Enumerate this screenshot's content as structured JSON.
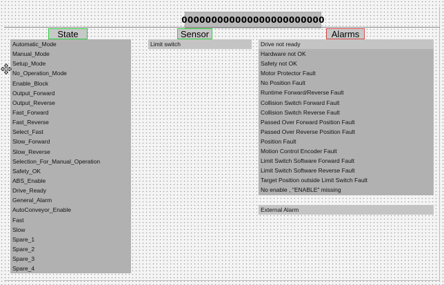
{
  "title": "000000000000000000000000",
  "headers": {
    "state": "State",
    "sensor": "Sensor",
    "alarms": "Alarms"
  },
  "state_items": [
    "Automatic_Mode",
    "Manual_Mode",
    "Setup_Mode",
    "No_Operation_Mode",
    "Enable_Block",
    "Output_Forward",
    "Output_Reverse",
    "Fast_Forward",
    "Fast_Reverse",
    "Select_Fast",
    "Slow_Forward",
    "Slow_Reverse",
    "Selection_For_Manual_Operation",
    "Safety_OK",
    "ABS_Enable",
    "Drive_Ready",
    "General_Alarm",
    "AutoConveyor_Enable",
    "Fast",
    "Slow",
    "Spare_1",
    "Spare_2",
    "Spare_3",
    "Spare_4"
  ],
  "sensor_items": [
    "Limit switch"
  ],
  "alarm_items": [
    "Drive not ready",
    "Hardware not OK",
    "Safety not OK",
    "Motor Protector Fault",
    "No Position Fault",
    "Runtime Forward/Reverse Fault",
    "Collision Switch Forward Fault",
    "Collision Switch Reverse Fault",
    "Passed Over Forward Position Fault",
    "Passed Over Reverse Position Fault",
    "Position Fault",
    "Motion Control Encoder Fault",
    "Limit Switch Software Forward Fault",
    "Limit Switch Software Reverse Fault",
    "Target Position outside Limit Switch Fault",
    "No enable , \"ENABLE\" missing"
  ],
  "external_alarm": "External Alarm",
  "colors": {
    "state_border": "#2bcf3c",
    "sensor_border": "#2bcf3c",
    "alarms_border": "#d94a4a",
    "panel": "#b1b1b1"
  },
  "icons": {
    "cursor": "move-cursor-icon"
  }
}
